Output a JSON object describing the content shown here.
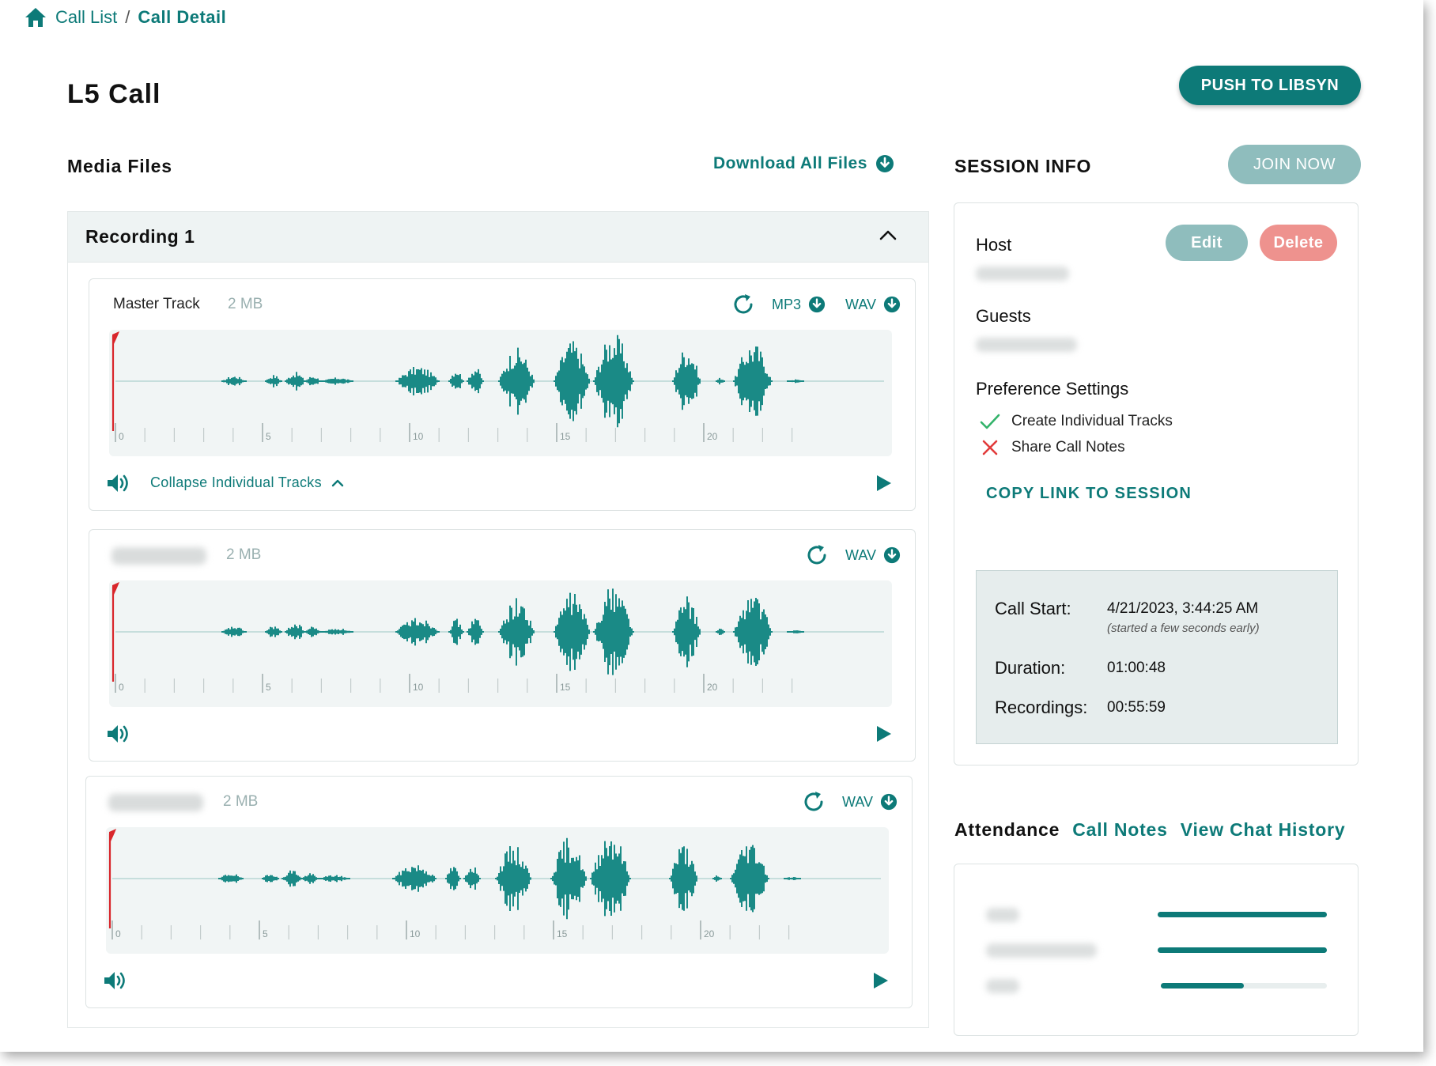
{
  "breadcrumb": {
    "home_icon": "home-icon",
    "parent": "Call List",
    "separator": "/",
    "current": "Call Detail"
  },
  "page": {
    "title": "L5 Call"
  },
  "actions": {
    "push_label": "PUSH TO LIBSYN",
    "join_label": "JOIN NOW"
  },
  "media": {
    "heading": "Media Files",
    "download_all": "Download All Files",
    "recording_title": "Recording 1",
    "tracks": [
      {
        "name": "Master Track",
        "size": "2 MB",
        "formats": [
          "MP3",
          "WAV"
        ],
        "collapse_label": "Collapse Individual Tracks"
      },
      {
        "name": "",
        "size": "2 MB",
        "formats": [
          "WAV"
        ]
      },
      {
        "name": "",
        "size": "2 MB",
        "formats": [
          "WAV"
        ]
      }
    ],
    "timeline_labels": [
      "0",
      "5",
      "10",
      "15",
      "20"
    ]
  },
  "session": {
    "heading": "SESSION INFO",
    "host_label": "Host",
    "guests_label": "Guests",
    "edit_label": "Edit",
    "delete_label": "Delete",
    "pref_heading": "Preference Settings",
    "prefs": [
      {
        "label": "Create Individual Tracks",
        "enabled": true
      },
      {
        "label": "Share Call Notes",
        "enabled": false
      }
    ],
    "copy_link": "COPY LINK TO SESSION",
    "call_start_label": "Call Start:",
    "call_start_value": "4/21/2023, 3:44:25 AM",
    "call_start_note": "(started a few seconds early)",
    "duration_label": "Duration:",
    "duration_value": "01:00:48",
    "recordings_label": "Recordings:",
    "recordings_value": "00:55:59"
  },
  "attendance": {
    "tabs": [
      "Attendance",
      "Call Notes",
      "View Chat History"
    ],
    "bars": [
      1.0,
      1.0,
      0.5
    ]
  },
  "colors": {
    "accent": "#0d7a78",
    "join": "#8fbdbd",
    "delete": "#ee928e",
    "wave": "#1a8a86",
    "playhead": "#d9262b"
  }
}
